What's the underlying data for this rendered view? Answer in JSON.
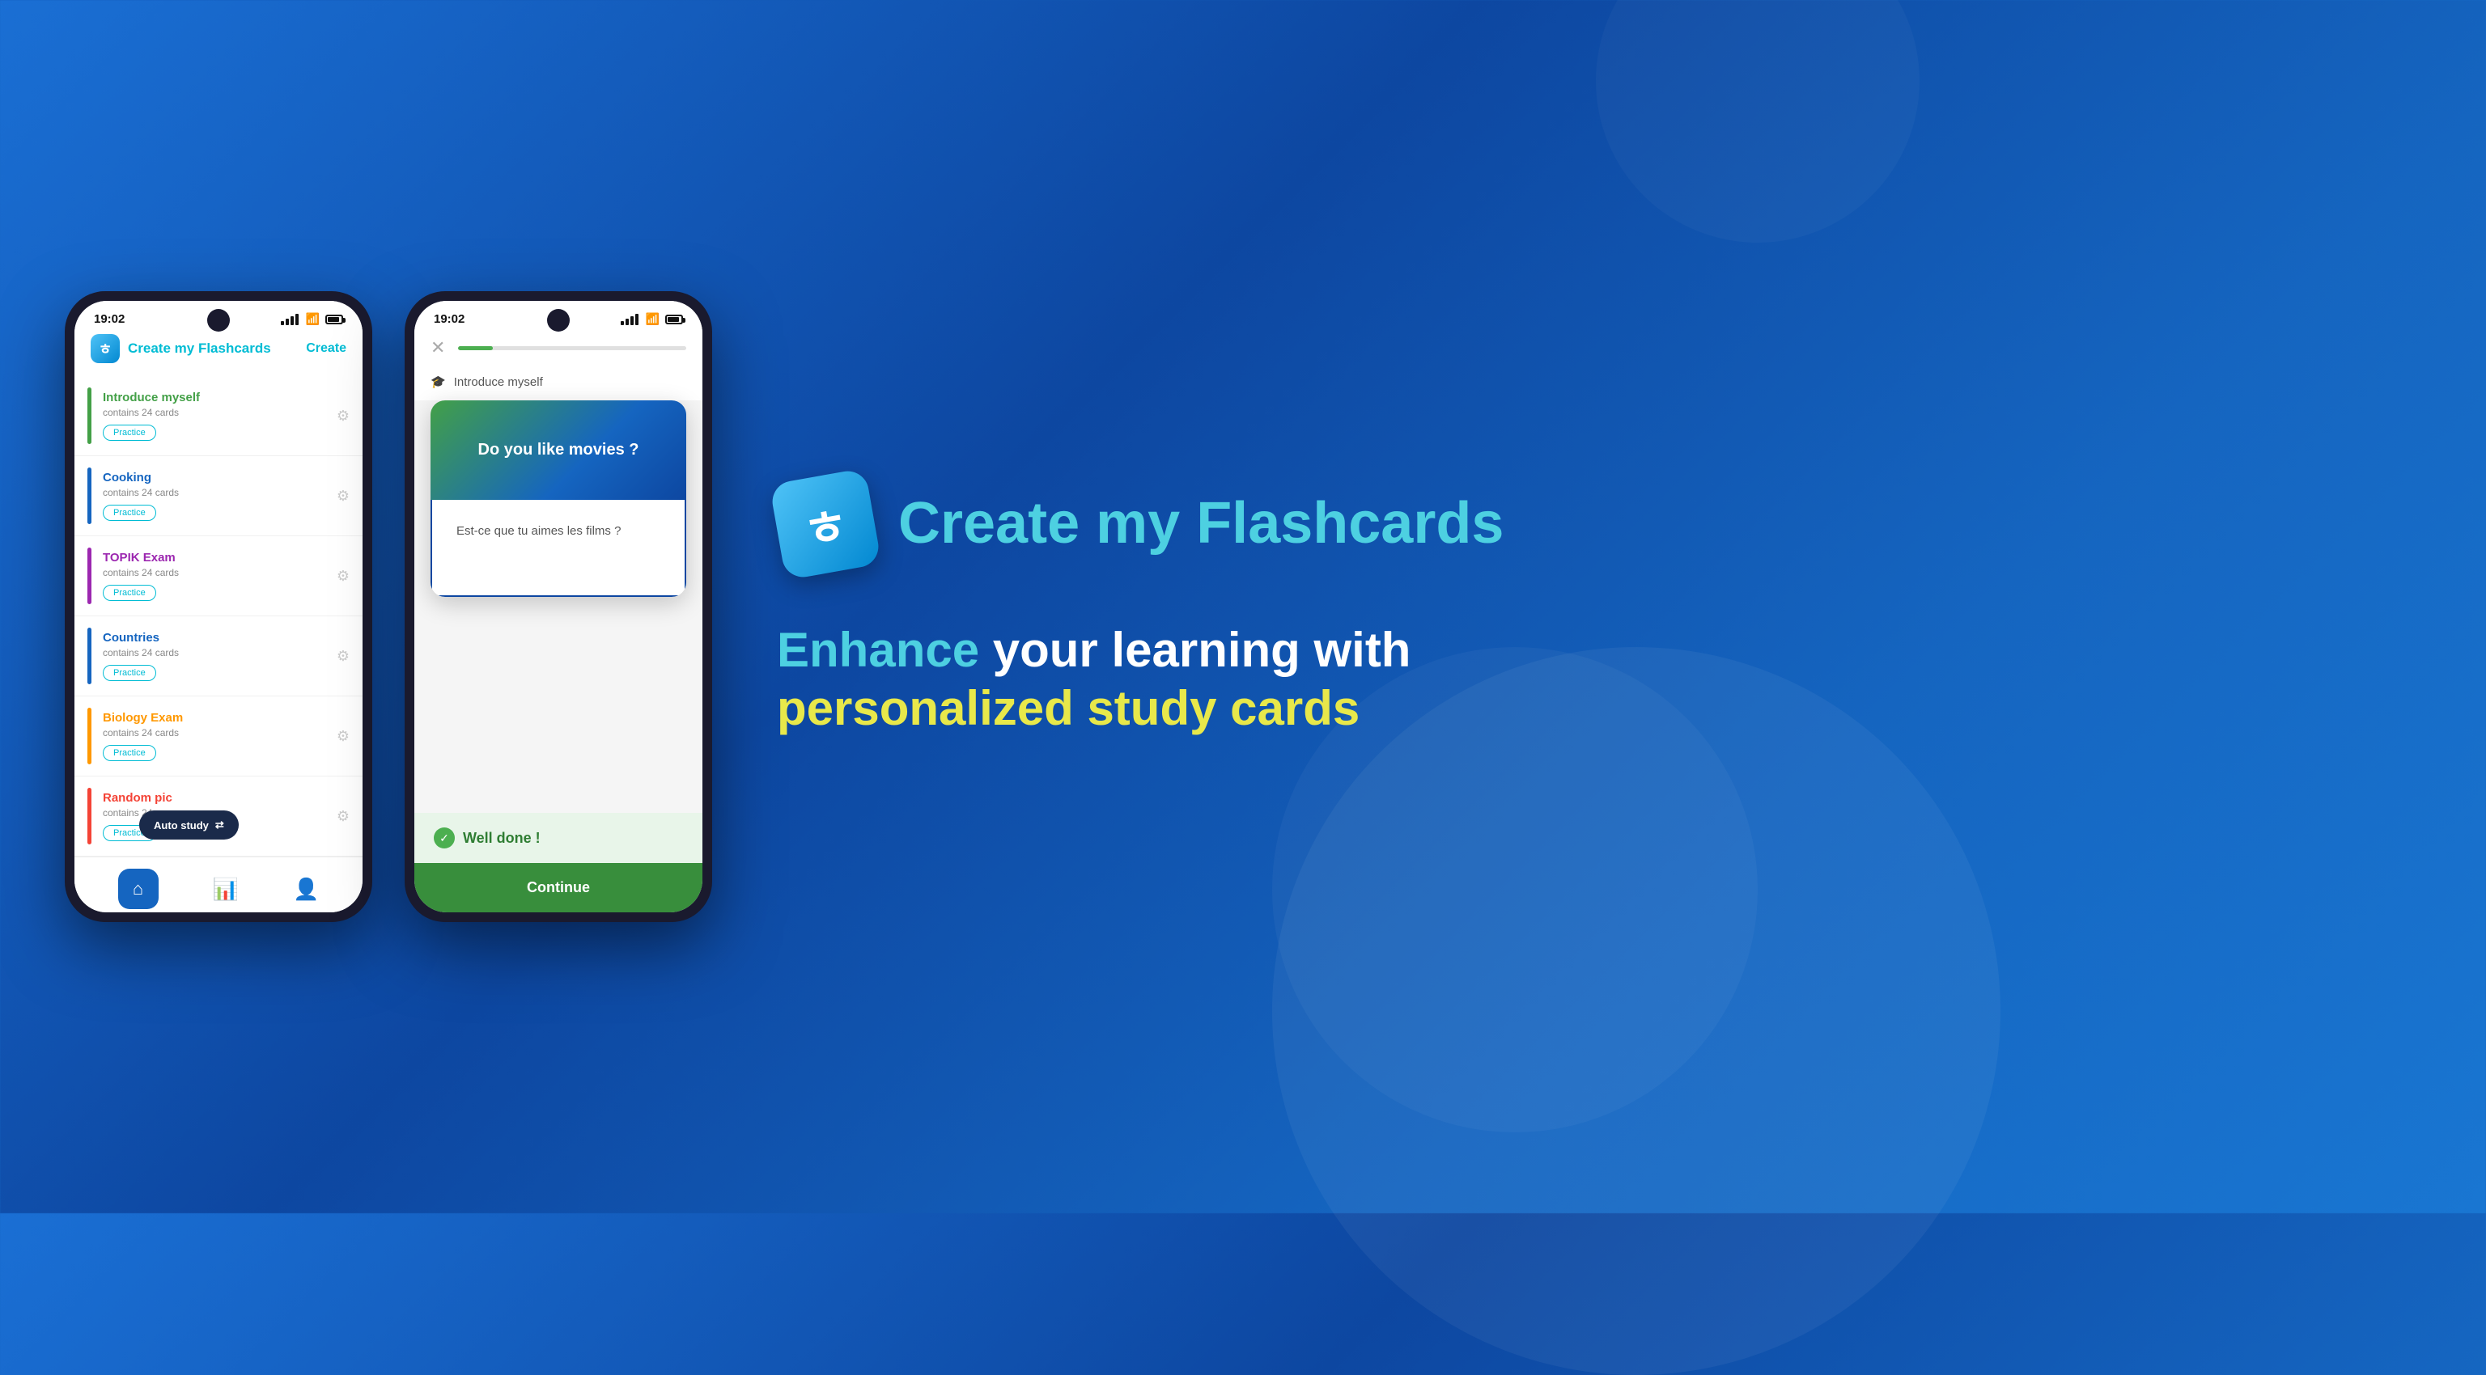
{
  "statusBar": {
    "time": "19:02",
    "icons": "signal wifi battery"
  },
  "phone1": {
    "header": {
      "logoText": "Create my ",
      "logoSpan": "Flashcards",
      "createBtn": "Create"
    },
    "items": [
      {
        "title": "Introduce myself",
        "subtitle": "contains 24 cards",
        "color": "#43a047",
        "practice": "Practice"
      },
      {
        "title": "Cooking",
        "subtitle": "contains 24 cards",
        "color": "#1565c0",
        "practice": "Practice"
      },
      {
        "title": "TOPIK Exam",
        "subtitle": "contains 24 cards",
        "color": "#9c27b0",
        "practice": "Practice"
      },
      {
        "title": "Countries",
        "subtitle": "contains 24 cards",
        "color": "#1565c0",
        "practice": "Practice"
      },
      {
        "title": "Biology Exam",
        "subtitle": "contains 24 cards",
        "color": "#ff9800",
        "practice": "Practice"
      },
      {
        "title": "Random pic",
        "subtitle": "contains 24 ca",
        "color": "#f44336",
        "practice": "Practice"
      }
    ],
    "autoStudy": "Auto study"
  },
  "phone2": {
    "subject": "Introduce myself",
    "question": "Do you like movies ?",
    "answer": "Est-ce que tu aimes les films ?",
    "wellDone": "Well done !",
    "continue": "Continue"
  },
  "marketing": {
    "logoChar": "ㅎ",
    "brandPart1": "Create my ",
    "brandPart2": "Flashcards",
    "tagline1": "Enhance ",
    "tagline2": "your learning with",
    "tagline3": "personalized study cards"
  }
}
